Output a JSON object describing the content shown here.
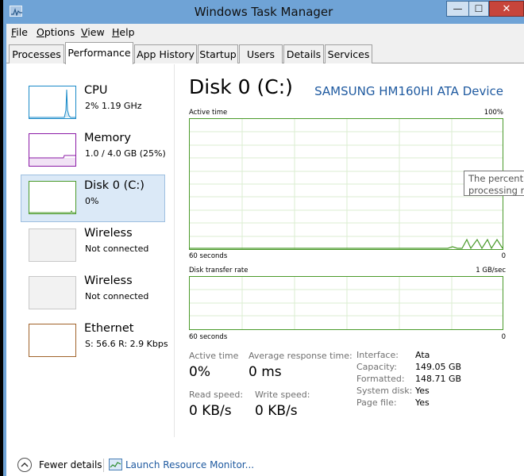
{
  "window": {
    "title": "Windows Task Manager",
    "min_glyph": "—",
    "max_glyph": "☐",
    "close_glyph": "✕"
  },
  "menu": {
    "file": {
      "ul": "F",
      "rest": "ile"
    },
    "options": {
      "ul": "O",
      "rest": "ptions"
    },
    "view": {
      "ul": "V",
      "rest": "iew"
    },
    "help": {
      "ul": "H",
      "rest": "elp"
    }
  },
  "tabs": [
    "Processes",
    "Performance",
    "App History",
    "Startup",
    "Users",
    "Details",
    "Services"
  ],
  "active_tab": "Performance",
  "resources": [
    {
      "title": "CPU",
      "sub": "2% 1.19 GHz",
      "color": "#1a8ac8"
    },
    {
      "title": "Memory",
      "sub": "1.0 / 4.0 GB (25%)",
      "color": "#8b1aa6"
    },
    {
      "title": "Disk 0 (C:)",
      "sub": "0%",
      "color": "#4a9a2a"
    },
    {
      "title": "Wireless",
      "sub": "Not connected",
      "color": "#c8c8c8"
    },
    {
      "title": "Wireless",
      "sub": "Not connected",
      "color": "#c8c8c8"
    },
    {
      "title": "Ethernet",
      "sub": "S: 56.6  R: 2.9 Kbps",
      "color": "#a0622a"
    }
  ],
  "selected_resource": "Disk 0 (C:)",
  "main": {
    "title": "Disk 0 (C:)",
    "device": "SAMSUNG HM160HI ATA Device",
    "active_graph": {
      "label": "Active time",
      "max": "100%",
      "left_bottom": "60 seconds",
      "right_bottom": "0"
    },
    "transfer_graph": {
      "label": "Disk transfer rate",
      "max": "1 GB/sec",
      "left_bottom": "60 seconds",
      "right_bottom": "0"
    },
    "tooltip": {
      "line1": "The percent of",
      "line2": "processing rea"
    }
  },
  "stats": {
    "active_time": {
      "label": "Active time",
      "value": "0%"
    },
    "avg_response": {
      "label": "Average response time:",
      "value": "0 ms"
    },
    "read_speed": {
      "label": "Read speed:",
      "value": "0 KB/s"
    },
    "write_speed": {
      "label": "Write speed:",
      "value": "0 KB/s"
    }
  },
  "info": [
    {
      "key": "Interface:",
      "value": "Ata"
    },
    {
      "key": "Capacity:",
      "value": "149.05 GB"
    },
    {
      "key": "Formatted:",
      "value": "148.71 GB"
    },
    {
      "key": "System disk:",
      "value": "Yes"
    },
    {
      "key": "Page file:",
      "value": "Yes"
    }
  ],
  "footer": {
    "fewer_details": "Fewer details",
    "launch_monitor": "Launch Resource Monitor..."
  }
}
